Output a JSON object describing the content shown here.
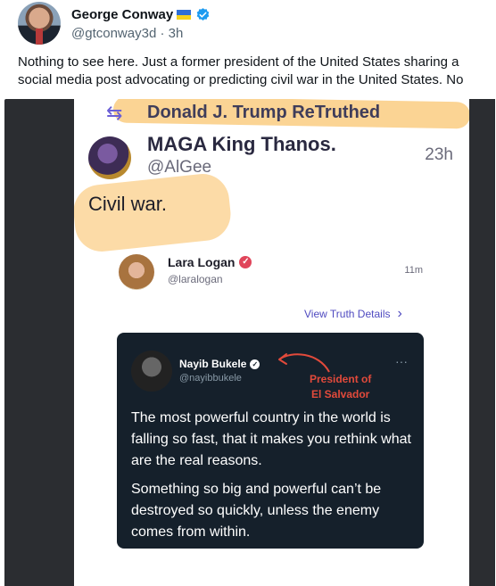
{
  "tweet": {
    "author_name": "George Conway",
    "handle": "@gtconway3d",
    "separator": "·",
    "timestamp": "3h",
    "text": "Nothing to see here. Just a former president of the United States sharing a social media post advocating or predicting civil war in the United States. No biggie."
  },
  "truth_screenshot": {
    "retruth_label": "Donald J. Trump ReTruthed",
    "post": {
      "display_name": "MAGA King Thanos.",
      "handle": "@AlGee",
      "time": "23h",
      "text": "Civil war."
    },
    "quoted": {
      "display_name": "Lara Logan",
      "handle": "@laralogan",
      "time": "11m",
      "view_details_label": "View Truth Details"
    },
    "embedded_tweet": {
      "display_name": "Nayib Bukele",
      "handle": "@nayibbukele",
      "more": "···",
      "annotation_line1": "President of",
      "annotation_line2": "El Salvador",
      "paragraph1": "The most powerful country in the world is falling so fast, that it makes you rethink what are the real reasons.",
      "paragraph2": "Something so big and powerful can’t be destroyed so quickly, unless the enemy comes from within."
    }
  },
  "colors": {
    "highlight": "#f8b03c",
    "annotation": "#e24a3b",
    "verified": "#1d9bf0",
    "truth_accent": "#4f4ac0"
  }
}
